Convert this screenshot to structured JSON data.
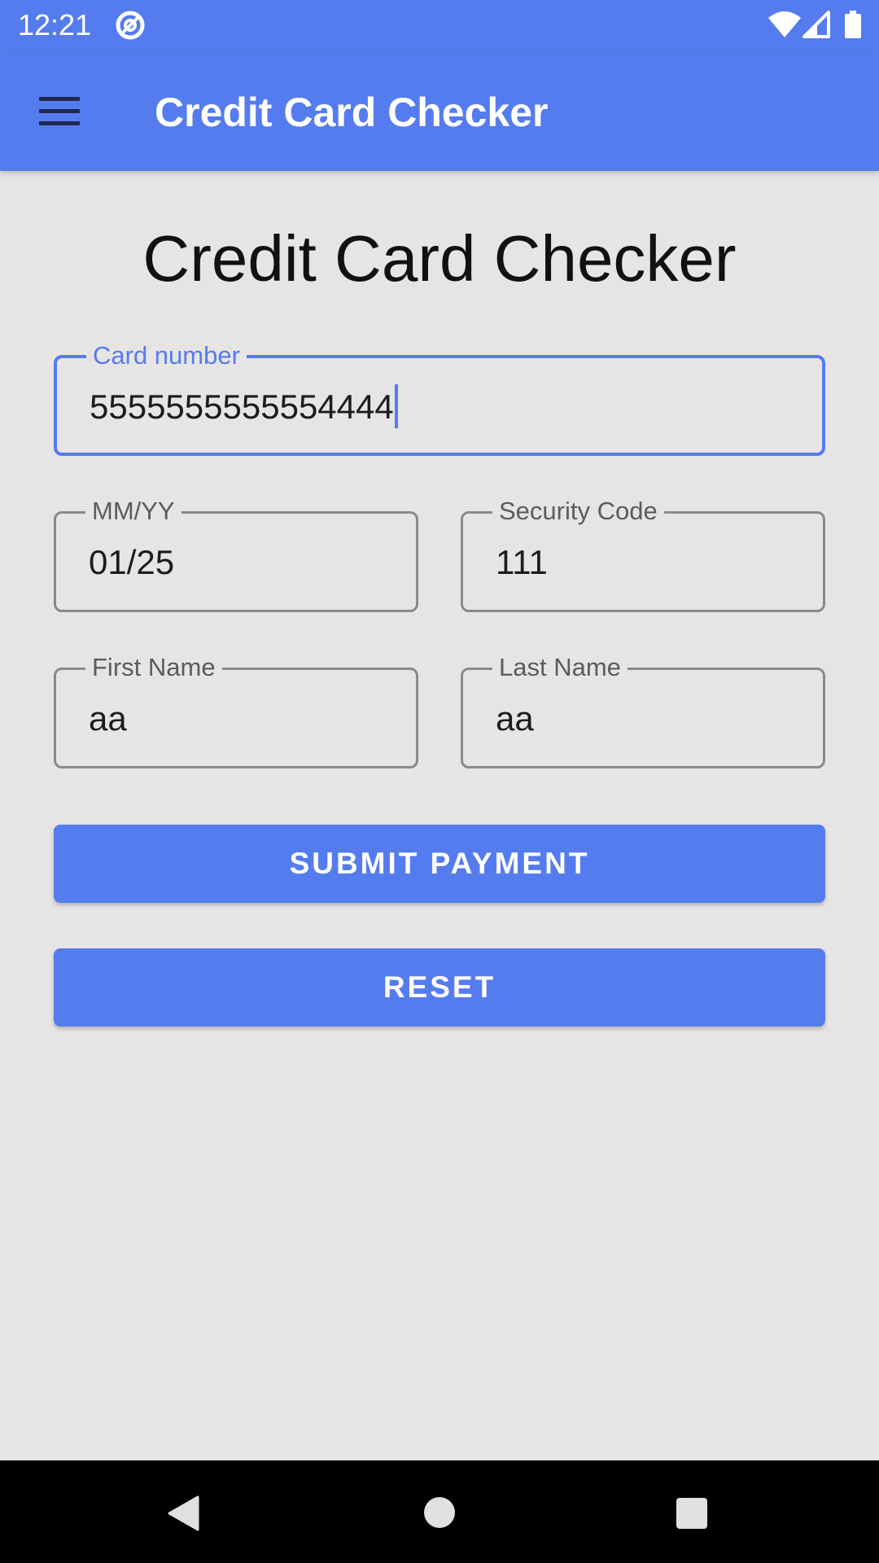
{
  "status_bar": {
    "time": "12:21",
    "notification_icon": "at-sign-icon",
    "wifi_icon": "wifi-icon",
    "signal_icon": "cell-signal-icon",
    "battery_icon": "battery-icon"
  },
  "app_bar": {
    "menu_icon": "hamburger-menu-icon",
    "title": "Credit Card Checker"
  },
  "main": {
    "heading": "Credit Card Checker",
    "fields": {
      "card_number": {
        "label": "Card number",
        "value": "5555555555554444"
      },
      "expiry": {
        "label": "MM/YY",
        "value": "01/25"
      },
      "security_code": {
        "label": "Security Code",
        "value": "111"
      },
      "first_name": {
        "label": "First Name",
        "value": "aa"
      },
      "last_name": {
        "label": "Last Name",
        "value": "aa"
      }
    },
    "buttons": {
      "submit": "SUBMIT PAYMENT",
      "reset": "RESET"
    }
  },
  "nav_bar": {
    "back_icon": "back-triangle-icon",
    "home_icon": "home-circle-icon",
    "recents_icon": "recents-square-icon"
  },
  "colors": {
    "primary": "#557cee",
    "background": "#e7e4e4",
    "outline": "#8a8a8a",
    "nav_background": "#000000"
  }
}
